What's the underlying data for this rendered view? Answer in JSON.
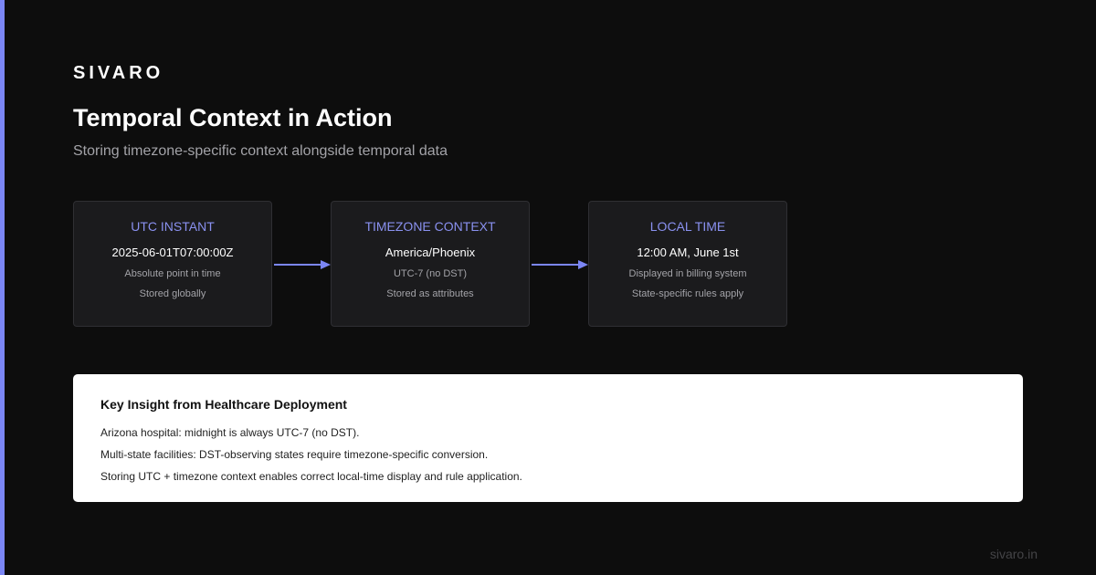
{
  "brand": "SIVARO",
  "title": "Temporal Context in Action",
  "subtitle": "Storing timezone-specific context alongside temporal data",
  "colors": {
    "background": "#0d0d0d",
    "accent": "#7b86f5",
    "card_background": "#1b1b1d",
    "card_title": "#8a91f0",
    "insight_background": "#ffffff"
  },
  "flow": {
    "cards": [
      {
        "title": "UTC INSTANT",
        "value": "2025-06-01T07:00:00Z",
        "lines": [
          "Absolute point in time",
          "Stored globally"
        ]
      },
      {
        "title": "TIMEZONE CONTEXT",
        "value": "America/Phoenix",
        "lines": [
          "UTC-7 (no DST)",
          "Stored as attributes"
        ]
      },
      {
        "title": "LOCAL TIME",
        "value": "12:00 AM, June 1st",
        "lines": [
          "Displayed in billing system",
          "State-specific rules apply"
        ]
      }
    ]
  },
  "insight": {
    "title": "Key Insight from Healthcare Deployment",
    "lines": [
      "Arizona hospital: midnight is always UTC-7 (no DST).",
      "Multi-state facilities: DST-observing states require timezone-specific conversion.",
      "Storing UTC + timezone context enables correct local-time display and rule application."
    ]
  },
  "footer": "sivaro.in"
}
